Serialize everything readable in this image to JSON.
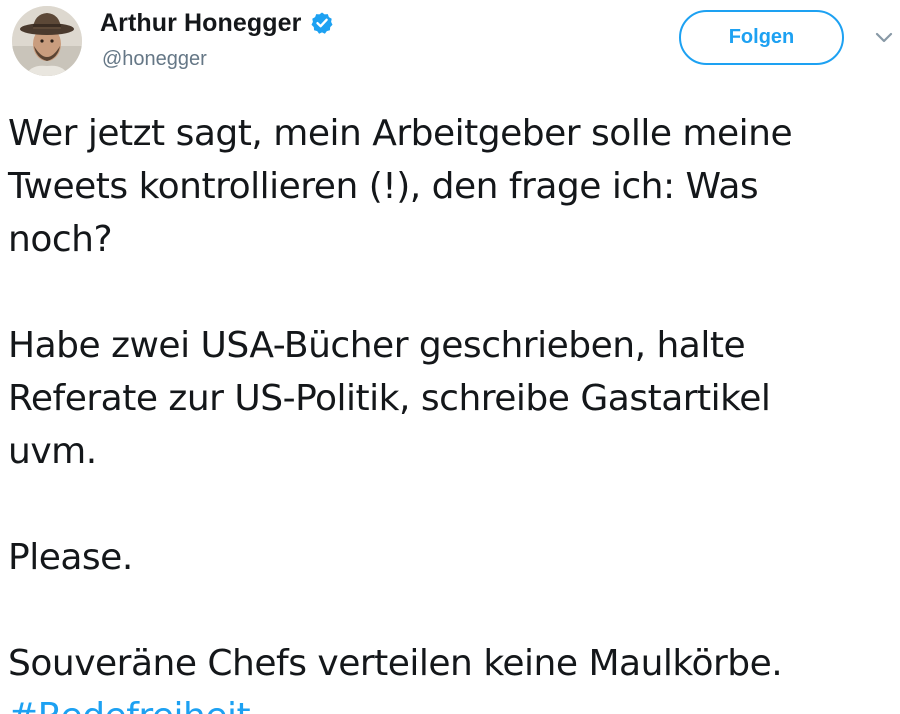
{
  "author": {
    "display_name": "Arthur Honegger",
    "handle": "@honegger",
    "verified_icon": "verified-badge-icon",
    "avatar": "profile-photo-man-with-hat"
  },
  "actions": {
    "follow_label": "Folgen",
    "more_icon": "chevron-down-icon"
  },
  "tweet": {
    "paragraphs": [
      {
        "lines": [
          "Wer jetzt sagt, mein Arbeitgeber solle meine",
          "Tweets kontrollieren (!), den frage ich: Was",
          "noch?"
        ]
      },
      {
        "lines": [
          "Habe zwei USA-Bücher geschrieben, halte",
          "Referate zur US-Politik, schreibe Gastartikel",
          "uvm."
        ]
      },
      {
        "lines": [
          "Please."
        ]
      },
      {
        "lines": [
          "Souveräne Chefs verteilen keine Maulkörbe."
        ]
      }
    ],
    "hashtag": "#Redefreiheit"
  },
  "colors": {
    "accent": "#1da1f2",
    "text": "#14171a",
    "secondary_text": "#657786"
  }
}
